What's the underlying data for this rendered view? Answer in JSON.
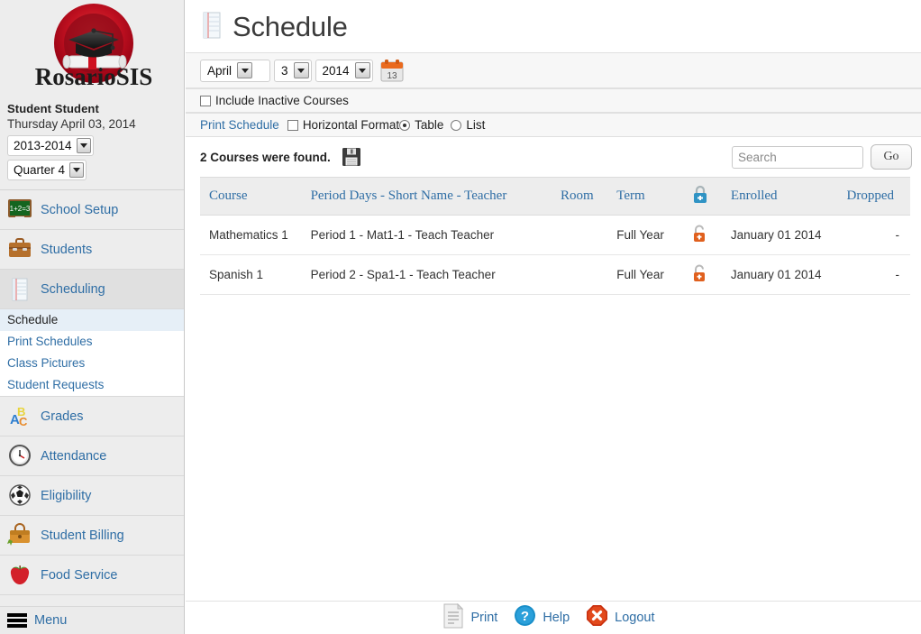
{
  "sidebar": {
    "logo_text": "RosarioSIS",
    "user_name": "Student Student",
    "date_text": "Thursday April 03, 2014",
    "school_year": "2013-2014",
    "marking_period": "Quarter 4",
    "nav": [
      {
        "label": "School Setup",
        "icon": "chalkboard-icon"
      },
      {
        "label": "Students",
        "icon": "briefcase-icon"
      },
      {
        "label": "Scheduling",
        "icon": "notebook-icon"
      },
      {
        "label": "Grades",
        "icon": "abc-blocks-icon"
      },
      {
        "label": "Attendance",
        "icon": "clock-icon"
      },
      {
        "label": "Eligibility",
        "icon": "soccer-ball-icon"
      },
      {
        "label": "Student Billing",
        "icon": "satchel-icon"
      },
      {
        "label": "Food Service",
        "icon": "apple-icon"
      }
    ],
    "sub_items": [
      {
        "label": "Schedule",
        "selected": true
      },
      {
        "label": "Print Schedules",
        "selected": false
      },
      {
        "label": "Class Pictures",
        "selected": false
      },
      {
        "label": "Student Requests",
        "selected": false
      }
    ],
    "menu_label": "Menu"
  },
  "main": {
    "page_title": "Schedule",
    "date_picker": {
      "month": "April",
      "day": "3",
      "year": "2014",
      "calendar_icon_day": "13"
    },
    "include_inactive_label": "Include Inactive Courses",
    "print_schedule_label": "Print Schedule",
    "horizontal_format_label": "Horizontal Format",
    "table_label": "Table",
    "list_label": "List",
    "results_text": "2 Courses were found.",
    "search": {
      "placeholder": "Search",
      "value": "",
      "go_label": "Go"
    },
    "table": {
      "headers": {
        "course": "Course",
        "period": "Period Days - Short Name - Teacher",
        "room": "Room",
        "term": "Term",
        "lock": "",
        "enrolled": "Enrolled",
        "dropped": "Dropped"
      },
      "rows": [
        {
          "course": "Mathematics 1",
          "period": "Period 1 - Mat1-1 - Teach Teacher",
          "room": "",
          "term": "Full Year",
          "enrolled": "January 01 2014",
          "dropped": "-"
        },
        {
          "course": "Spanish 1",
          "period": "Period 2 - Spa1-1 - Teach Teacher",
          "room": "",
          "term": "Full Year",
          "enrolled": "January 01 2014",
          "dropped": "-"
        }
      ]
    }
  },
  "footer": {
    "print_label": "Print",
    "help_label": "Help",
    "logout_label": "Logout"
  },
  "colors": {
    "link_blue": "#2f6ea5",
    "header_blue": "#2f6ea5",
    "logo_red": "#c8102e",
    "accent_orange": "#e8601c",
    "sidebar_bg": "#ededed",
    "selected_bg": "#e6eff7"
  }
}
